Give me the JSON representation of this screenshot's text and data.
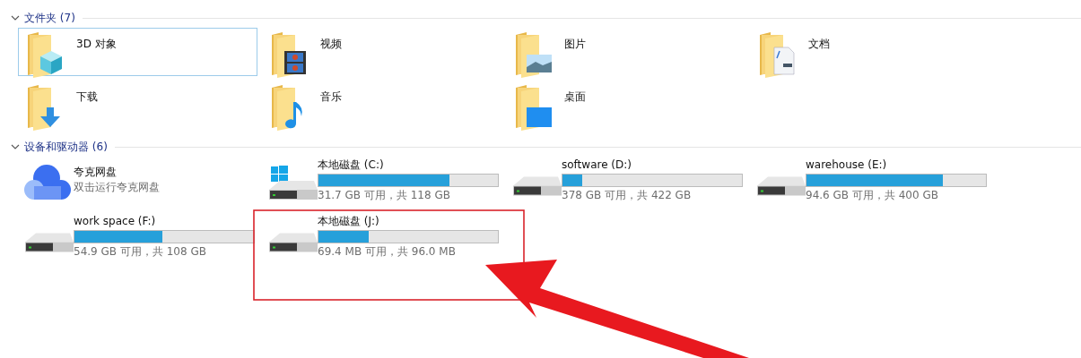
{
  "sections": [
    {
      "title": "文件夹 (7)",
      "expanded": true,
      "kind": "folders",
      "items": [
        {
          "name": "3D 对象",
          "kind": "objects3d",
          "selected": true
        },
        {
          "name": "视频",
          "kind": "video",
          "selected": false
        },
        {
          "name": "图片",
          "kind": "pictures",
          "selected": false
        },
        {
          "name": "文档",
          "kind": "documents",
          "selected": false
        },
        {
          "name": "下载",
          "kind": "downloads",
          "selected": false
        },
        {
          "name": "音乐",
          "kind": "music",
          "selected": false
        },
        {
          "name": "桌面",
          "kind": "desktop",
          "selected": false
        }
      ]
    },
    {
      "title": "设备和驱动器 (6)",
      "expanded": true,
      "kind": "drives",
      "items": [
        {
          "name": "夸克网盘",
          "kind": "cloud",
          "subtitle": "双击运行夸克网盘"
        },
        {
          "name": "本地磁盘 (C:)",
          "kind": "system-drive",
          "level": 0.73,
          "subtitle": "31.7 GB 可用，共 118 GB"
        },
        {
          "name": "software (D:)",
          "kind": "drive",
          "level": 0.11,
          "subtitle": "378 GB 可用，共 422 GB"
        },
        {
          "name": "warehouse (E:)",
          "kind": "drive",
          "level": 0.76,
          "subtitle": "94.6 GB 可用，共 400 GB"
        },
        {
          "name": "work space (F:)",
          "kind": "drive",
          "level": 0.49,
          "subtitle": "54.9 GB 可用，共 108 GB"
        },
        {
          "name": "本地磁盘 (J:)",
          "kind": "drive",
          "level": 0.28,
          "subtitle": "69.4 MB 可用，共 96.0 MB"
        }
      ]
    }
  ]
}
